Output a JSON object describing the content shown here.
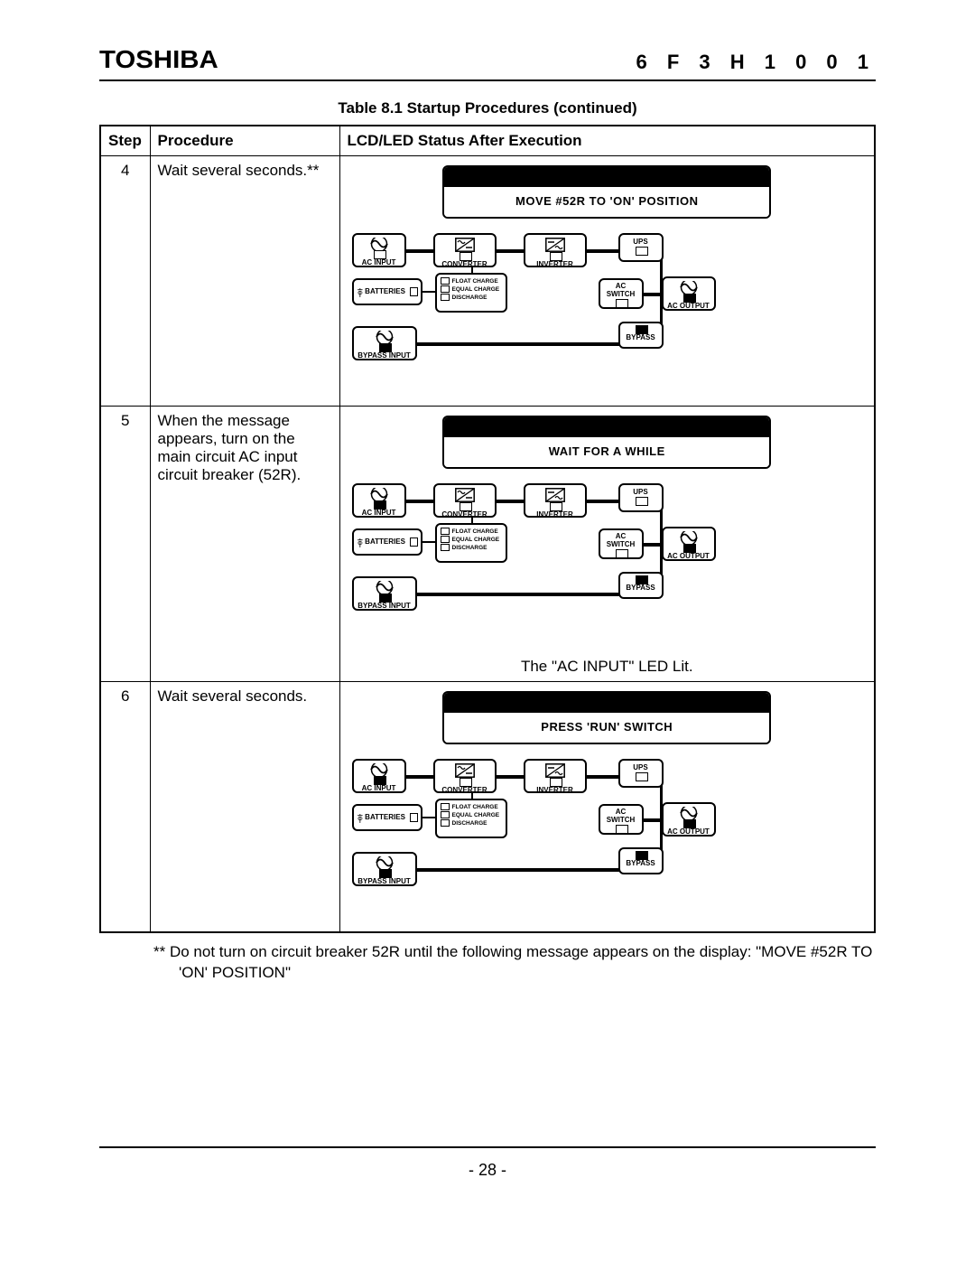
{
  "header": {
    "brand": "TOSHIBA",
    "doc_number": "6 F 3 H 1 0 0 1"
  },
  "table": {
    "caption": "Table 8.1    Startup Procedures (continued)",
    "columns": {
      "step": "Step",
      "procedure": "Procedure",
      "status": "LCD/LED Status After Execution"
    },
    "rows": [
      {
        "step": "4",
        "procedure": "Wait several seconds.**",
        "lcd": "MOVE #52R TO 'ON' POSITION",
        "ac_input_on": false,
        "extra": ""
      },
      {
        "step": "5",
        "procedure": "When the message appears, turn on the main circuit AC input circuit breaker (52R).",
        "lcd": "WAIT FOR A WHILE",
        "ac_input_on": true,
        "extra": "The \"AC INPUT\" LED Lit."
      },
      {
        "step": "6",
        "procedure": "Wait several seconds.",
        "lcd": "PRESS 'RUN' SWITCH",
        "ac_input_on": true,
        "extra": ""
      }
    ]
  },
  "diagram_labels": {
    "ac_input": "AC INPUT",
    "converter": "CONVERTER",
    "inverter": "INVERTER",
    "ups": "UPS",
    "ac_switch": "AC\nSWITCH",
    "ac_output": "AC OUTPUT",
    "batteries": "BATTERIES",
    "bypass_input": "BYPASS INPUT",
    "bypass": "BYPASS",
    "float": "FLOAT CHARGE",
    "equal": "EQUAL CHARGE",
    "discharge": "DISCHARGE"
  },
  "footnote": "**   Do not turn on circuit breaker 52R until the following message appears on the display: \"MOVE #52R TO 'ON' POSITION\"",
  "page_number": "-  28  -"
}
